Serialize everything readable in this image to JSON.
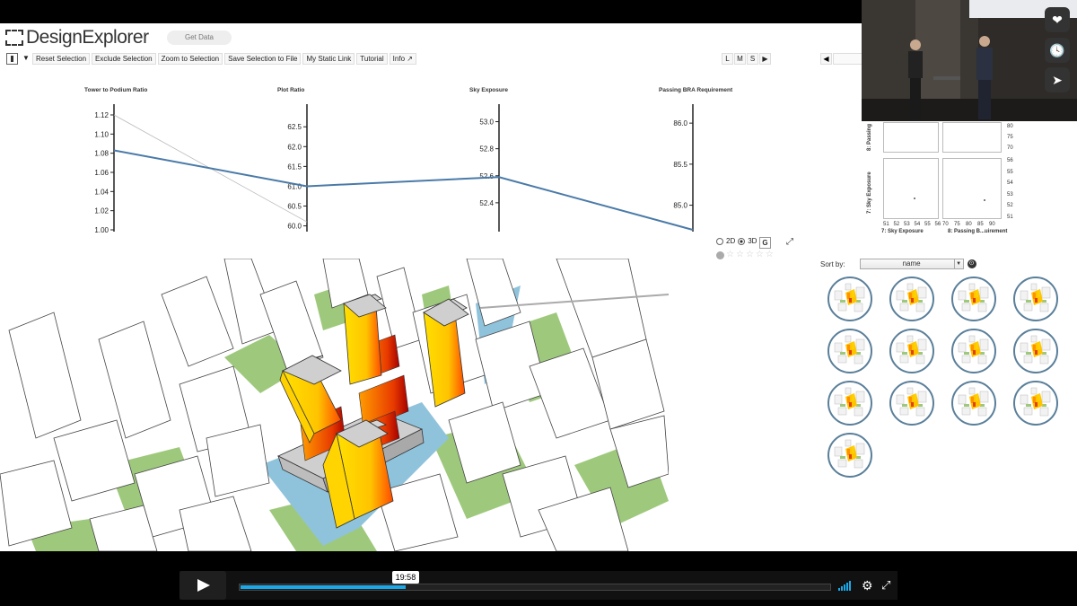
{
  "app": {
    "brand": "DesignExplorer",
    "get_data": "Get Data"
  },
  "toolbar": {
    "items": [
      "Reset Selection",
      "Exclude Selection",
      "Zoom to Selection",
      "Save Selection to File",
      "My Static Link",
      "Tutorial",
      "Info"
    ],
    "size_buttons": [
      "L",
      "M",
      "S"
    ],
    "next_arrow": "▶",
    "prev_arrow": "◀"
  },
  "parallel": {
    "axes": [
      {
        "name": "Tower to Podium Ratio",
        "ticks": [
          "1.12",
          "1.10",
          "1.08",
          "1.06",
          "1.04",
          "1.02",
          "1.00"
        ],
        "min": 1.0,
        "max": 1.12
      },
      {
        "name": "Plot Ratio",
        "ticks": [
          "62.5",
          "62.0",
          "61.5",
          "61.0",
          "60.5",
          "60.0"
        ],
        "min": 59.9,
        "max": 62.8
      },
      {
        "name": "Sky Exposure",
        "ticks": [
          "53.0",
          "52.8",
          "52.6",
          "52.4"
        ],
        "min": 52.2,
        "max": 53.05
      },
      {
        "name": "Passing BRA Requirement",
        "ticks": [
          "86.0",
          "85.5",
          "85.0"
        ],
        "min": 84.7,
        "max": 86.1
      }
    ],
    "selected_line": [
      1.083,
      61.0,
      52.59,
      84.7
    ],
    "faint_line": [
      1.12,
      60.1
    ]
  },
  "viewer": {
    "mode_2d": "2D",
    "mode_3d": "3D",
    "g_label": "G",
    "expand": "⤢",
    "stars": [
      "☆",
      "☆",
      "☆",
      "☆",
      "☆"
    ]
  },
  "mini": {
    "y_labels_top": [
      "80",
      "75",
      "70"
    ],
    "y_labels_bottom": [
      "56",
      "55",
      "54",
      "53",
      "52",
      "51"
    ],
    "x_labels_left": [
      "51",
      "52",
      "53",
      "54",
      "55",
      "56"
    ],
    "x_labels_right": [
      "70",
      "75",
      "80",
      "85",
      "90"
    ],
    "axis_top_left": "8: Passing",
    "axis_bottom_left": "7: Sky Exposure",
    "x_title_left": "7: Sky Exposure",
    "x_title_right": "8: Passing B...uirement"
  },
  "thumbs": {
    "sort_label": "Sort by:",
    "sort_value": "name",
    "sort_caret": "▼",
    "sort_dir": "⊙",
    "count": 13
  },
  "player": {
    "time": "19:58",
    "progress": 0.28,
    "play_label": "",
    "settings": "⚙",
    "fullscreen": "⤢"
  },
  "side_buttons": [
    "❤",
    "🕓",
    "➤"
  ],
  "colors": {
    "pc_line": "#4a7aa8",
    "track_fill": "#1aa8e8",
    "green": "#9ec97c",
    "water": "#8fc3dc"
  }
}
